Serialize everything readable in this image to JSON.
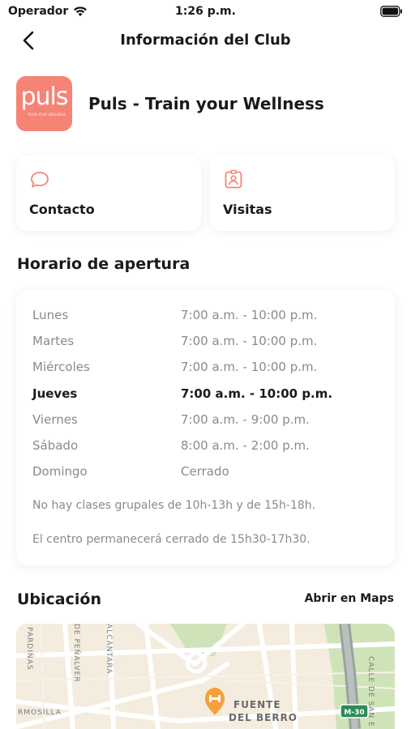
{
  "status_bar": {
    "carrier": "Operador",
    "time": "1:26 p.m."
  },
  "nav": {
    "title": "Información del Club"
  },
  "club": {
    "name": "Puls - Train your Wellness",
    "logo_text": "puls",
    "logo_subtext": "TRAIN YOUR WELLNESS"
  },
  "actions": [
    {
      "label": "Contacto",
      "icon": "chat-bubble-icon"
    },
    {
      "label": "Visitas",
      "icon": "badge-icon"
    }
  ],
  "hours": {
    "title": "Horario de apertura",
    "rows": [
      {
        "day": "Lunes",
        "hours": "7:00 a.m. - 10:00 p.m.",
        "today": false
      },
      {
        "day": "Martes",
        "hours": "7:00 a.m. - 10:00 p.m.",
        "today": false
      },
      {
        "day": "Miércoles",
        "hours": "7:00 a.m. - 10:00 p.m.",
        "today": false
      },
      {
        "day": "Jueves",
        "hours": "7:00 a.m. - 10:00 p.m.",
        "today": true
      },
      {
        "day": "Viernes",
        "hours": "7:00 a.m. - 9:00 p.m.",
        "today": false
      },
      {
        "day": "Sábado",
        "hours": "8:00 a.m. - 2:00 p.m.",
        "today": false
      },
      {
        "day": "Domingo",
        "hours": "Cerrado",
        "today": false
      }
    ],
    "notes": [
      "No hay clases grupales de 10h-13h y de 15h-18h.",
      "El centro permanecerá cerrado de 15h30-17h30."
    ]
  },
  "location": {
    "title": "Ubicación",
    "maps_link": "Abrir en Maps",
    "map_labels": {
      "street_1": "PARDIÑAS",
      "street_2": "DE PEÑALVER",
      "street_3": "ALCÁNTARA",
      "street_4": "CALLE DE SAN E",
      "street_5": "RMOSILLA",
      "district_1": "FUENTE",
      "district_2": "DEL BERRO",
      "highway": "M-30"
    }
  },
  "colors": {
    "accent": "#f58476",
    "text": "#1a1a1a",
    "muted": "#8a8a8a"
  }
}
